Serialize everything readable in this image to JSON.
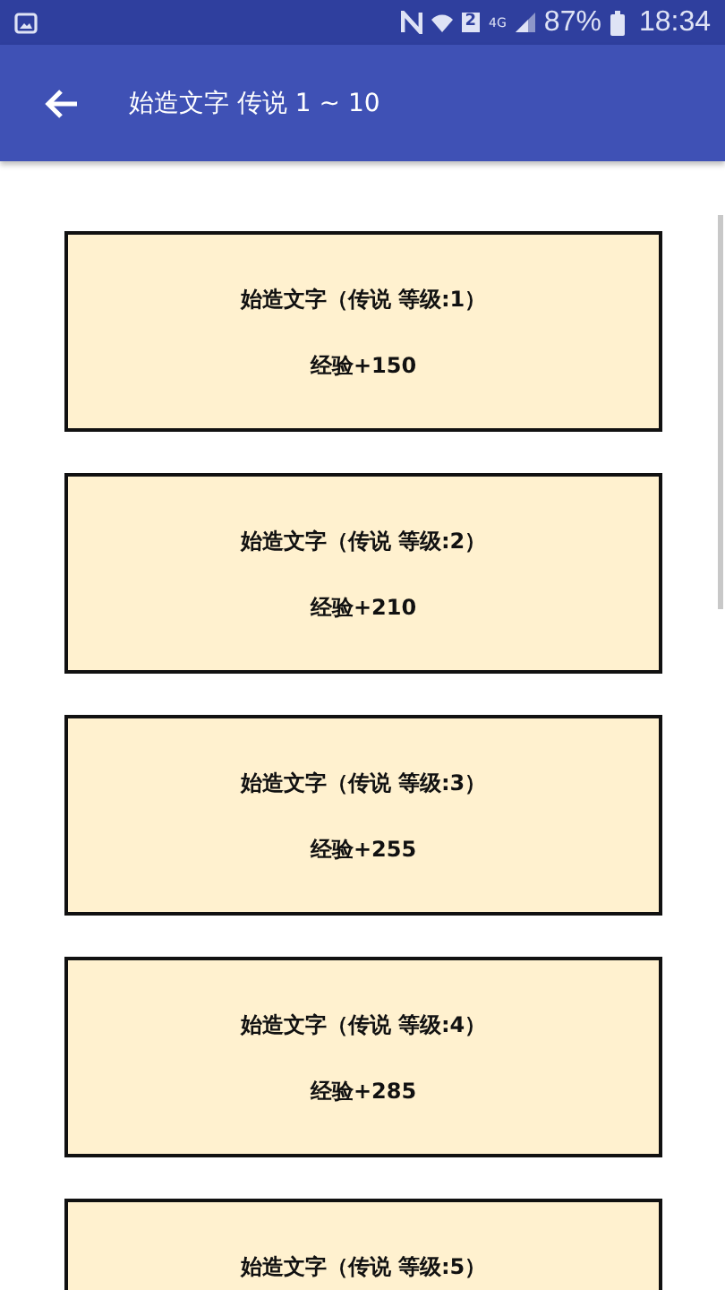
{
  "status_bar": {
    "sim_slot": "2",
    "network": "4G",
    "battery": "87%",
    "time": "18:34"
  },
  "app_bar": {
    "title": "始造文字 传说 1 ~ 10"
  },
  "cards": [
    {
      "title": "始造文字（传说 等级:1）",
      "reward": "经验+150"
    },
    {
      "title": "始造文字（传说 等级:2）",
      "reward": "经验+210"
    },
    {
      "title": "始造文字（传说 等级:3）",
      "reward": "经验+255"
    },
    {
      "title": "始造文字（传说 等级:4）",
      "reward": "经验+285"
    },
    {
      "title": "始造文字（传说 等级:5）"
    }
  ]
}
